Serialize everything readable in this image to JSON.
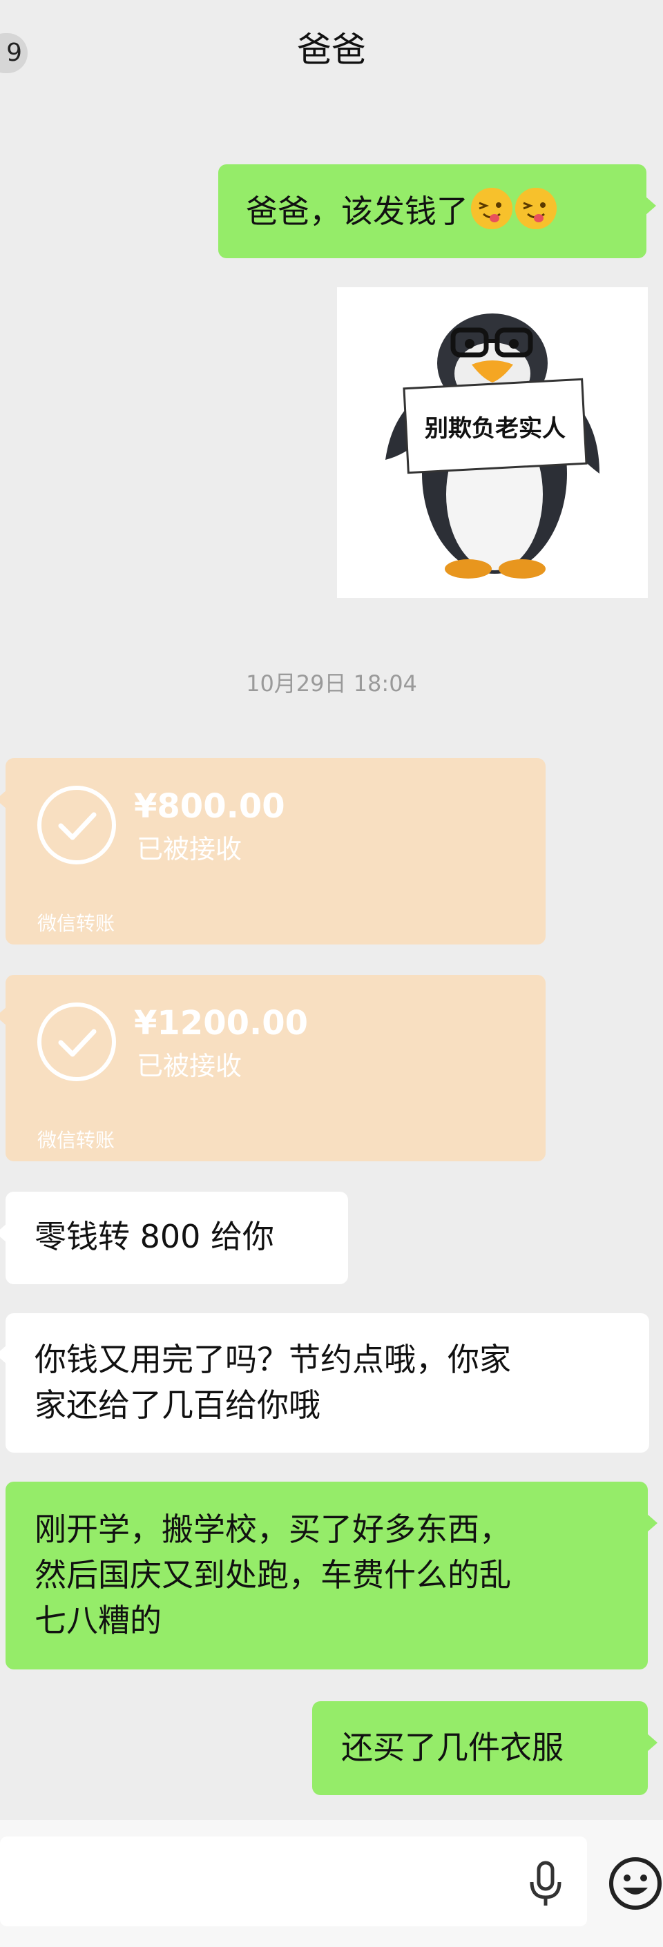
{
  "header": {
    "back_count": "9",
    "title": "爸爸"
  },
  "messages": {
    "m1": {
      "text": "爸爸，该发钱了",
      "emoji": "squinting-tongue-face-emoji"
    },
    "sticker": {
      "caption": "别欺负老实人",
      "icon": "penguin-sticker"
    },
    "timestamp": "10月29日 18:04",
    "transfer1": {
      "amount": "¥800.00",
      "status": "已被接收",
      "footer": "微信转账"
    },
    "transfer2": {
      "amount": "¥1200.00",
      "status": "已被接收",
      "footer": "微信转账"
    },
    "m2": {
      "text": "零钱转 800 给你"
    },
    "m3": {
      "line1": "你钱又用完了吗？节约点哦，你家",
      "line2": "家还给了几百给你哦"
    },
    "m4": {
      "line1": "刚开学，搬学校，买了好多东西，",
      "line2": "然后国庆又到处跑，车费什么的乱",
      "line3": "七八糟的"
    },
    "m5": {
      "text": "还买了几件衣服"
    }
  },
  "input_bar": {
    "voice_icon": "microphone-icon",
    "emoji_icon": "smiley-face-icon"
  },
  "colors": {
    "green_bubble": "#95ec69",
    "transfer_bg": "#f8dfc1",
    "background": "#ededed"
  }
}
